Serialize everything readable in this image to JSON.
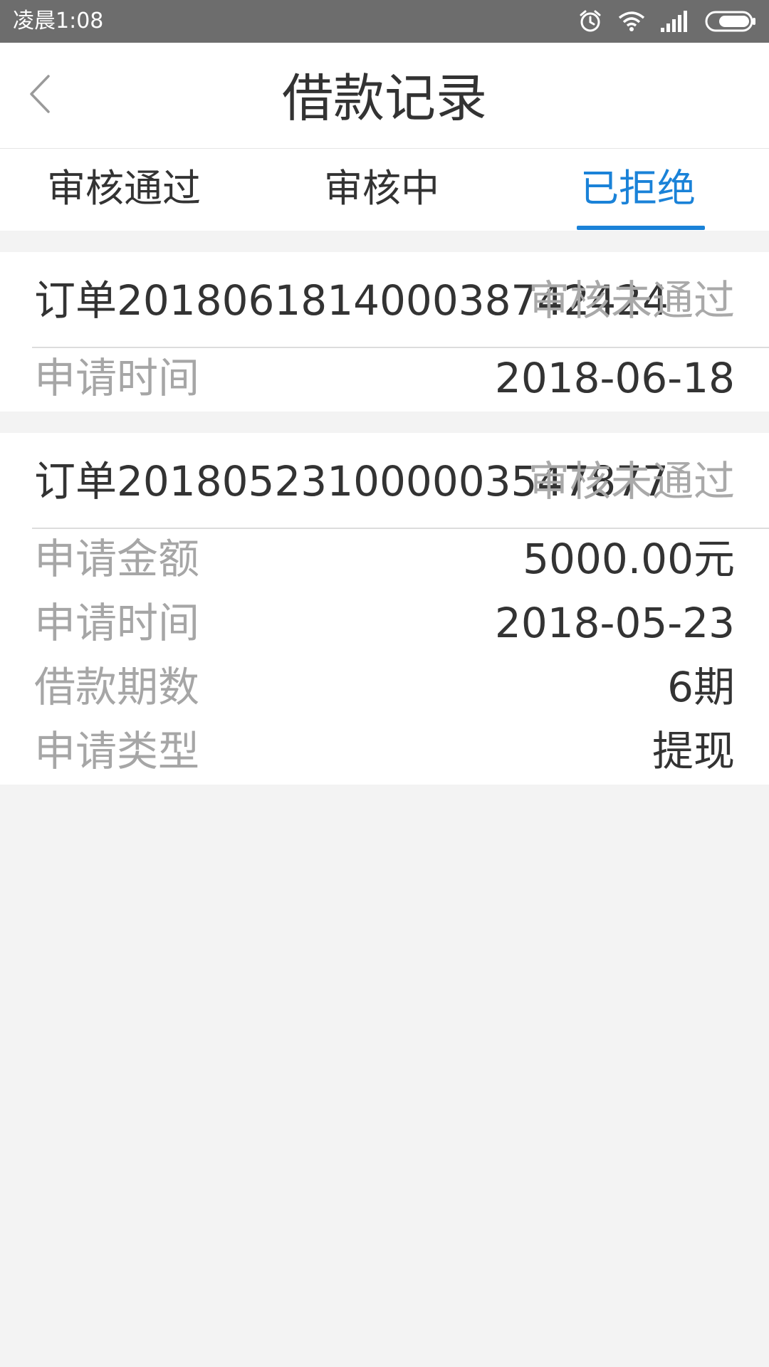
{
  "status_bar": {
    "time": "凌晨1:08",
    "icons": [
      "alarm-icon",
      "wifi-icon",
      "signal-icon",
      "battery-icon"
    ]
  },
  "header": {
    "title": "借款记录",
    "back_icon": "chevron-left-icon"
  },
  "tabs": [
    {
      "label": "审核通过",
      "active": false
    },
    {
      "label": "审核中",
      "active": false
    },
    {
      "label": "已拒绝",
      "active": true
    }
  ],
  "colors": {
    "accent": "#1a82d8",
    "status_bar": "#6d6d6d",
    "background": "#f3f3f3",
    "muted_text": "#a6a6a6",
    "primary_text": "#333333"
  },
  "records": [
    {
      "order_id": "订单201806181400038742424",
      "status": "审核未通过",
      "details": [
        {
          "label": "申请时间",
          "value": "2018-06-18"
        }
      ]
    },
    {
      "order_id": "订单201805231000003547877",
      "status": "审核未通过",
      "details": [
        {
          "label": "申请金额",
          "value": "5000.00元"
        },
        {
          "label": "申请时间",
          "value": "2018-05-23"
        },
        {
          "label": "借款期数",
          "value": "6期"
        },
        {
          "label": "申请类型",
          "value": "提现"
        }
      ]
    }
  ]
}
